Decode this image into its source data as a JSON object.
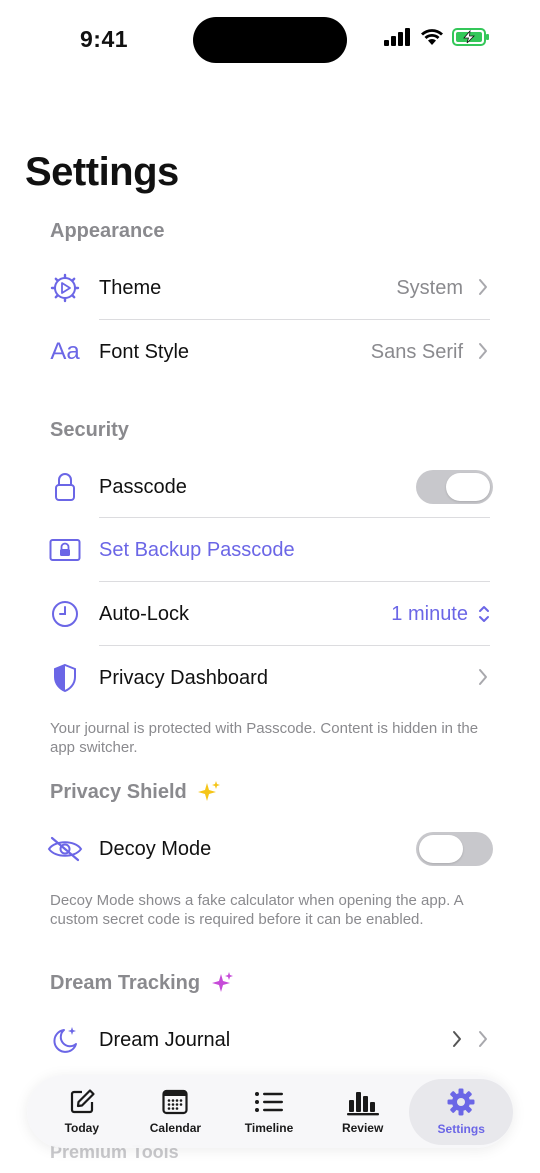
{
  "status": {
    "time": "9:41"
  },
  "title": "Settings",
  "sections": {
    "appearance": "Appearance",
    "security": "Security",
    "privacy_shield": "Privacy Shield",
    "dream_tracking": "Dream Tracking",
    "premium_tools": "Premium Tools"
  },
  "rows": {
    "theme": {
      "label": "Theme",
      "value": "System"
    },
    "font_style": {
      "label": "Font Style",
      "value": "Sans Serif"
    },
    "passcode": {
      "label": "Passcode",
      "enabled": true
    },
    "backup_passcode": {
      "label": "Set Backup Passcode"
    },
    "auto_lock": {
      "label": "Auto-Lock",
      "value": "1 minute"
    },
    "privacy_dashboard": {
      "label": "Privacy Dashboard"
    },
    "decoy_mode": {
      "label": "Decoy Mode",
      "enabled": false
    },
    "dream_journal": {
      "label": "Dream Journal"
    }
  },
  "footnotes": {
    "security": "Your journal is protected with Passcode. Content is hidden in the app switcher.",
    "decoy": "Decoy Mode shows a fake calculator when opening the app. A custom secret code is required before it can be enabled."
  },
  "tabs": [
    {
      "label": "Today",
      "icon": "compose-icon"
    },
    {
      "label": "Calendar",
      "icon": "calendar-icon"
    },
    {
      "label": "Timeline",
      "icon": "list-icon"
    },
    {
      "label": "Review",
      "icon": "bar-chart-icon"
    },
    {
      "label": "Settings",
      "icon": "gear-icon",
      "active": true
    }
  ],
  "colors": {
    "accent": "#6b66e6",
    "secondary_text": "#8a8a8e",
    "sparkle_yellow": "#f5c518",
    "sparkle_purple": "#c64bd8"
  }
}
